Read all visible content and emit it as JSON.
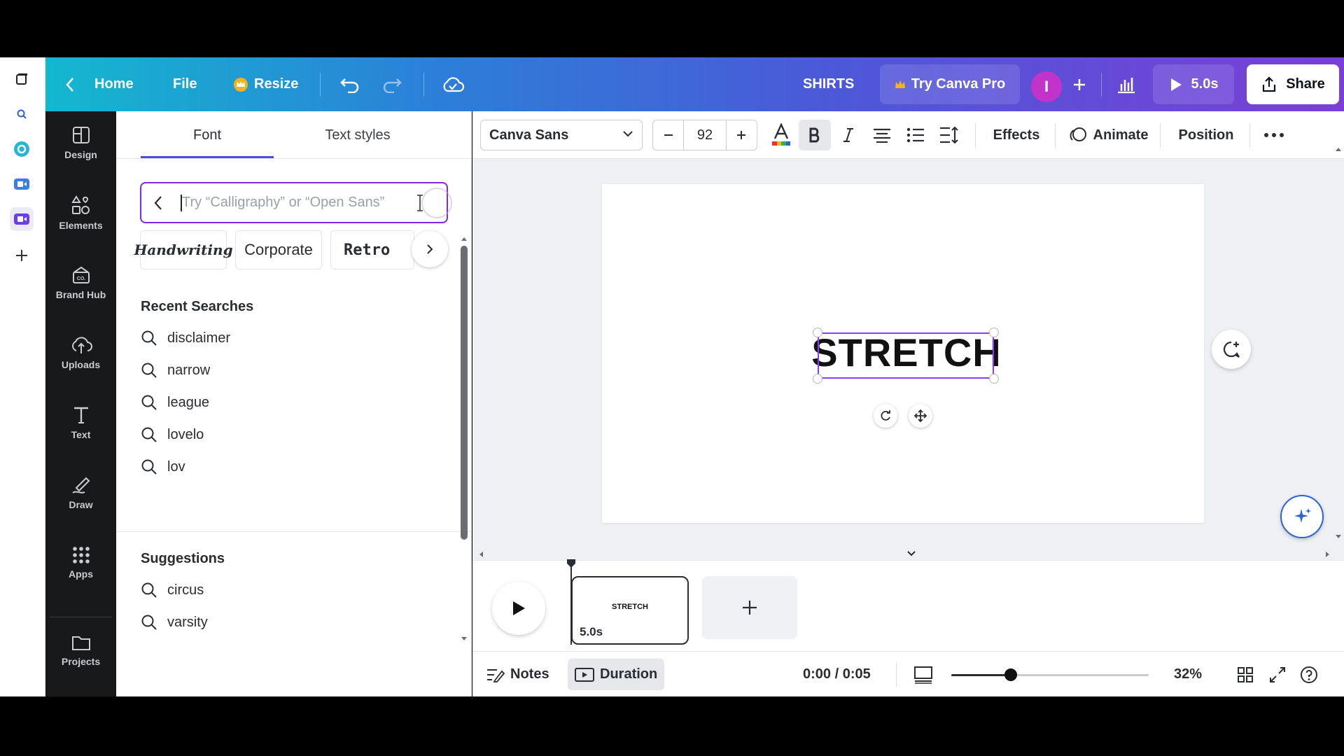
{
  "topbar": {
    "home_label": "Home",
    "file_label": "File",
    "resize_label": "Resize",
    "design_title": "SHIRTS",
    "try_pro_label": "Try Canva Pro",
    "avatar_initial": "I",
    "present_label": "5.0s",
    "share_label": "Share"
  },
  "sidenav": {
    "items": [
      {
        "label": "Design",
        "icon": "layout-icon"
      },
      {
        "label": "Elements",
        "icon": "shapes-icon"
      },
      {
        "label": "Brand Hub",
        "icon": "brand-icon"
      },
      {
        "label": "Uploads",
        "icon": "cloud-upload-icon"
      },
      {
        "label": "Text",
        "icon": "text-icon"
      },
      {
        "label": "Draw",
        "icon": "draw-icon"
      },
      {
        "label": "Apps",
        "icon": "apps-icon"
      },
      {
        "label": "Projects",
        "icon": "folder-icon"
      }
    ]
  },
  "panel": {
    "tab_font": "Font",
    "tab_text_styles": "Text styles",
    "search_placeholder": "Try “Calligraphy” or “Open Sans”",
    "chips": [
      "Handwriting",
      "Corporate",
      "Retro"
    ],
    "recent_heading": "Recent Searches",
    "recent": [
      "disclaimer",
      "narrow",
      "league",
      "lovelo",
      "lov"
    ],
    "suggestions_heading": "Suggestions",
    "suggestions": [
      "circus",
      "varsity"
    ]
  },
  "toolbar": {
    "font_name": "Canva Sans",
    "font_size": "92",
    "effects_label": "Effects",
    "animate_label": "Animate",
    "position_label": "Position"
  },
  "canvas": {
    "text": "STRETCH"
  },
  "timeline": {
    "clip_text": "STRETCH",
    "clip_duration": "5.0s"
  },
  "bottombar": {
    "notes_label": "Notes",
    "duration_label": "Duration",
    "time_readout": "0:00 / 0:05",
    "zoom_level": "32%",
    "zoom_fraction": 0.3
  },
  "colors": {
    "accent_purple": "#8b3dff",
    "sidenav_bg": "#18191b",
    "topbar_gradient_start": "#13b8cf",
    "topbar_gradient_end": "#7a3fd6"
  }
}
